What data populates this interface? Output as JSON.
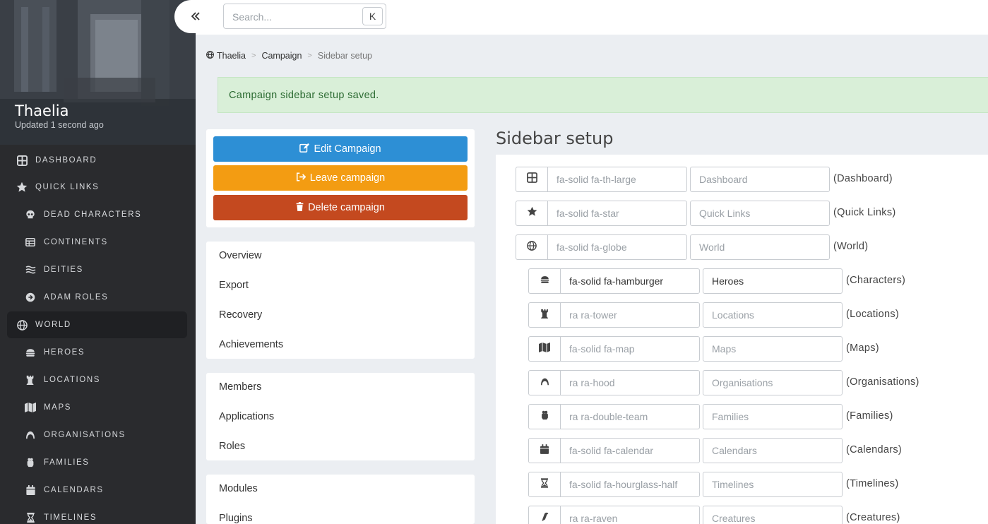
{
  "sidebar": {
    "campaign_name": "Thaelia",
    "updated": "Updated 1 second ago",
    "items": [
      {
        "label": "Dashboard",
        "icon": "th-large-icon",
        "level": "top"
      },
      {
        "label": "Quick Links",
        "icon": "star-icon",
        "level": "top"
      },
      {
        "label": "Dead Characters",
        "icon": "skull-icon",
        "level": "sub"
      },
      {
        "label": "Continents",
        "icon": "table-icon",
        "level": "sub"
      },
      {
        "label": "Deities",
        "icon": "water-icon",
        "level": "sub"
      },
      {
        "label": "Adam Roles",
        "icon": "arrow-circle-right-icon",
        "level": "sub"
      },
      {
        "label": "World",
        "icon": "globe-icon",
        "level": "top",
        "active": true
      },
      {
        "label": "Heroes",
        "icon": "hamburger-icon",
        "level": "sub"
      },
      {
        "label": "Locations",
        "icon": "tower-icon",
        "level": "sub"
      },
      {
        "label": "Maps",
        "icon": "map-icon",
        "level": "sub"
      },
      {
        "label": "Organisations",
        "icon": "hood-icon",
        "level": "sub"
      },
      {
        "label": "Families",
        "icon": "double-team-icon",
        "level": "sub"
      },
      {
        "label": "Calendars",
        "icon": "calendar-icon",
        "level": "sub"
      },
      {
        "label": "Timelines",
        "icon": "hourglass-icon",
        "level": "sub"
      }
    ]
  },
  "topbar": {
    "collapse_icon": "double-chevron-left-icon",
    "search_placeholder": "Search...",
    "search_shortcut": "K"
  },
  "breadcrumb": {
    "items": [
      "Thaelia",
      "Campaign"
    ],
    "current": "Sidebar setup",
    "separator": ">"
  },
  "alert": {
    "message": "Campaign sidebar setup saved.",
    "color": "#d9efd8"
  },
  "actions": {
    "edit": {
      "label": "Edit Campaign",
      "color": "#2d8fd5"
    },
    "leave": {
      "label": "Leave campaign",
      "color": "#f39c12"
    },
    "delete": {
      "label": "Delete campaign",
      "color": "#c4491f"
    }
  },
  "menu_groups": [
    [
      "Overview",
      "Export",
      "Recovery",
      "Achievements"
    ],
    [
      "Members",
      "Applications",
      "Roles"
    ],
    [
      "Modules",
      "Plugins"
    ]
  ],
  "main": {
    "title": "Sidebar setup",
    "rows": [
      {
        "icon": "th-large-icon",
        "icon_value": "",
        "icon_placeholder": "fa-solid fa-th-large",
        "name_value": "",
        "name_placeholder": "Dashboard",
        "original": "(Dashboard)",
        "indent": false
      },
      {
        "icon": "star-icon",
        "icon_value": "",
        "icon_placeholder": "fa-solid fa-star",
        "name_value": "",
        "name_placeholder": "Quick Links",
        "original": "(Quick Links)",
        "indent": false
      },
      {
        "icon": "globe-icon",
        "icon_value": "",
        "icon_placeholder": "fa-solid fa-globe",
        "name_value": "",
        "name_placeholder": "World",
        "original": "(World)",
        "indent": false
      },
      {
        "icon": "hamburger-icon",
        "icon_value": "fa-solid fa-hamburger",
        "icon_placeholder": "",
        "name_value": "Heroes",
        "name_placeholder": "",
        "original": "(Characters)",
        "indent": true
      },
      {
        "icon": "tower-icon",
        "icon_value": "",
        "icon_placeholder": "ra ra-tower",
        "name_value": "",
        "name_placeholder": "Locations",
        "original": "(Locations)",
        "indent": true
      },
      {
        "icon": "map-icon",
        "icon_value": "",
        "icon_placeholder": "fa-solid fa-map",
        "name_value": "",
        "name_placeholder": "Maps",
        "original": "(Maps)",
        "indent": true
      },
      {
        "icon": "hood-icon",
        "icon_value": "",
        "icon_placeholder": "ra ra-hood",
        "name_value": "",
        "name_placeholder": "Organisations",
        "original": "(Organisations)",
        "indent": true
      },
      {
        "icon": "double-team-icon",
        "icon_value": "",
        "icon_placeholder": "ra ra-double-team",
        "name_value": "",
        "name_placeholder": "Families",
        "original": "(Families)",
        "indent": true
      },
      {
        "icon": "calendar-icon",
        "icon_value": "",
        "icon_placeholder": "fa-solid fa-calendar",
        "name_value": "",
        "name_placeholder": "Calendars",
        "original": "(Calendars)",
        "indent": true
      },
      {
        "icon": "hourglass-icon",
        "icon_value": "",
        "icon_placeholder": "fa-solid fa-hourglass-half",
        "name_value": "",
        "name_placeholder": "Timelines",
        "original": "(Timelines)",
        "indent": true
      },
      {
        "icon": "raven-icon",
        "icon_value": "",
        "icon_placeholder": "ra ra-raven",
        "name_value": "",
        "name_placeholder": "Creatures",
        "original": "(Creatures)",
        "indent": true
      }
    ]
  }
}
